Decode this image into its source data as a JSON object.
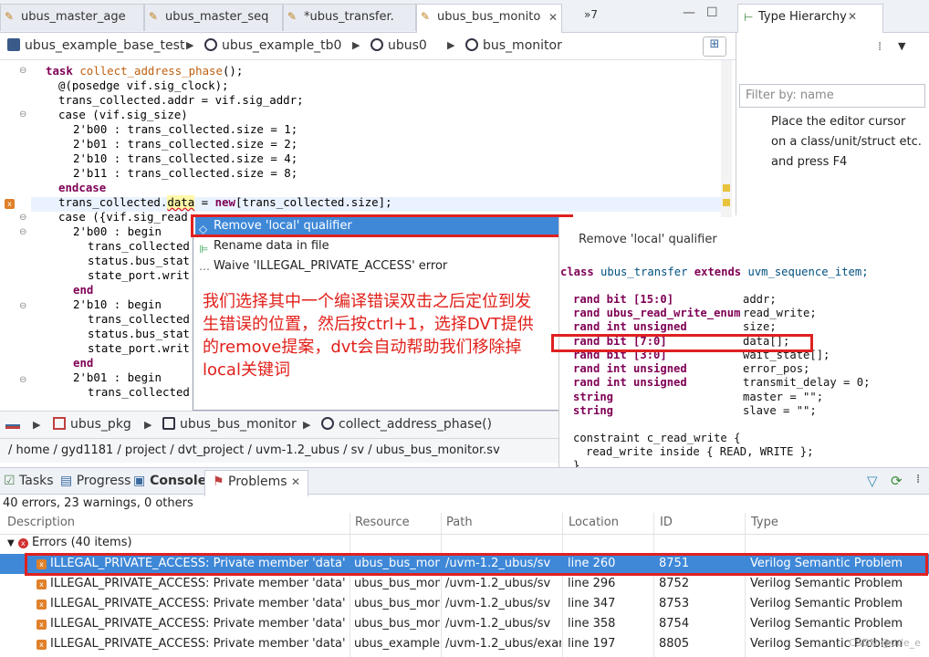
{
  "editor_tabs": [
    {
      "label": "ubus_master_age",
      "active": false
    },
    {
      "label": "ubus_master_seq",
      "active": false
    },
    {
      "label": "*ubus_transfer.",
      "active": false
    },
    {
      "label": "ubus_bus_monito",
      "active": true
    }
  ],
  "overflow_tabs": "»7",
  "breadcrumb": [
    "ubus_example_base_test",
    "ubus_example_tb0",
    "ubus0",
    "bus_monitor"
  ],
  "code": {
    "l1_kw": "task",
    "l1_name": "collect_address_phase",
    "l2": "@(posedge vif.sig_clock);",
    "l3": "trans_collected.addr = vif.sig_addr;",
    "l4": "case (vif.sig_size)",
    "l5": "2'b00 : trans_collected.size = 1;",
    "l6": "2'b01 : trans_collected.size = 2;",
    "l7": "2'b10 : trans_collected.size = 4;",
    "l8": "2'b11 : trans_collected.size = 8;",
    "l9": "endcase",
    "l10_a": "trans_collected.",
    "l10_b": "data",
    "l10_c": " = ",
    "l10_d": "new",
    "l10_e": "[trans_collected.size];",
    "l11": "case ({vif.sig_read",
    "l12": "2'b00 : begin",
    "l13": "trans_collected",
    "l14": "status.bus_stat",
    "l15": "state_port.writ",
    "l16": "end",
    "l17": "2'b10 : begin",
    "l18": "trans_collected",
    "l19": "status.bus_stat",
    "l20": "state_port.writ",
    "l21": "end",
    "l22": "2'b01 : begin",
    "l23": "trans_collected"
  },
  "quickfix": {
    "items": [
      "Remove 'local' qualifier",
      "Rename data in file",
      "Waive 'ILLEGAL_PRIVATE_ACCESS' error"
    ]
  },
  "annotation": "我们选择其中一个编译错误双击之后定位到发生错误的位置，然后按ctrl+1，选择DVT提供的remove提案，dvt会自动帮助我们移除掉local关键词",
  "preview": {
    "title": "Remove 'local' qualifier",
    "class_line": [
      "class",
      "ubus_transfer",
      "extends",
      "uvm_sequence_item;"
    ],
    "fields": [
      {
        "decl": "rand bit [15:0]",
        "name": "addr;"
      },
      {
        "decl": "rand ubus_read_write_enum",
        "name": "read_write;"
      },
      {
        "decl": "rand int unsigned",
        "name": "size;"
      },
      {
        "decl": "rand bit [7:0]",
        "name": "data[];"
      },
      {
        "decl": "rand bit [3:0]",
        "name": "wait_state[];"
      },
      {
        "decl": "rand int unsigned",
        "name": "error_pos;"
      },
      {
        "decl": "rand int unsigned",
        "name": "transmit_delay = 0;"
      },
      {
        "decl": "string",
        "name": "master = \"\";"
      },
      {
        "decl": "string",
        "name": "slave = \"\";"
      }
    ],
    "constraint": "constraint c_read_write {",
    "constraint_body": "read_write inside { READ, WRITE };",
    "closing": "}"
  },
  "editor_crumb": [
    "ubus_pkg",
    "ubus_bus_monitor",
    "collect_address_phase()"
  ],
  "file_path": "/ home / gyd1181 / project / dvt_project / uvm-1.2_ubus / sv / ubus_bus_monitor.sv",
  "type_hierarchy": {
    "title": "Type Hierarchy",
    "filter_placeholder": "Filter by: name",
    "message": "Place the editor cursor on a class/unit/struct etc. and press F4"
  },
  "problems": {
    "tabs": [
      "Tasks",
      "Progress",
      "Console",
      "Problems"
    ],
    "summary": "40 errors, 23 warnings, 0 others",
    "columns": [
      "Description",
      "Resource",
      "Path",
      "Location",
      "ID",
      "Type"
    ],
    "group": "Errors (40 items)",
    "rows": [
      {
        "desc": "ILLEGAL_PRIVATE_ACCESS: Private member 'data' of",
        "res": "ubus_bus_mon",
        "path": "/uvm-1.2_ubus/sv",
        "loc": "line 260",
        "id": "8751",
        "type": "Verilog Semantic Problem",
        "selected": true
      },
      {
        "desc": "ILLEGAL_PRIVATE_ACCESS: Private member 'data' of",
        "res": "ubus_bus_mon",
        "path": "/uvm-1.2_ubus/sv",
        "loc": "line 296",
        "id": "8752",
        "type": "Verilog Semantic Problem",
        "selected": false
      },
      {
        "desc": "ILLEGAL_PRIVATE_ACCESS: Private member 'data' of",
        "res": "ubus_bus_mon",
        "path": "/uvm-1.2_ubus/sv",
        "loc": "line 347",
        "id": "8753",
        "type": "Verilog Semantic Problem",
        "selected": false
      },
      {
        "desc": "ILLEGAL_PRIVATE_ACCESS: Private member 'data' of",
        "res": "ubus_bus_mon",
        "path": "/uvm-1.2_ubus/sv",
        "loc": "line 358",
        "id": "8754",
        "type": "Verilog Semantic Problem",
        "selected": false
      },
      {
        "desc": "ILLEGAL_PRIVATE_ACCESS: Private member 'data' of",
        "res": "ubus_example",
        "path": "/uvm-1.2_ubus/exam",
        "loc": "line 197",
        "id": "8805",
        "type": "Verilog Semantic Problem",
        "selected": false
      }
    ]
  },
  "watermark": "CSDN @ude_e"
}
